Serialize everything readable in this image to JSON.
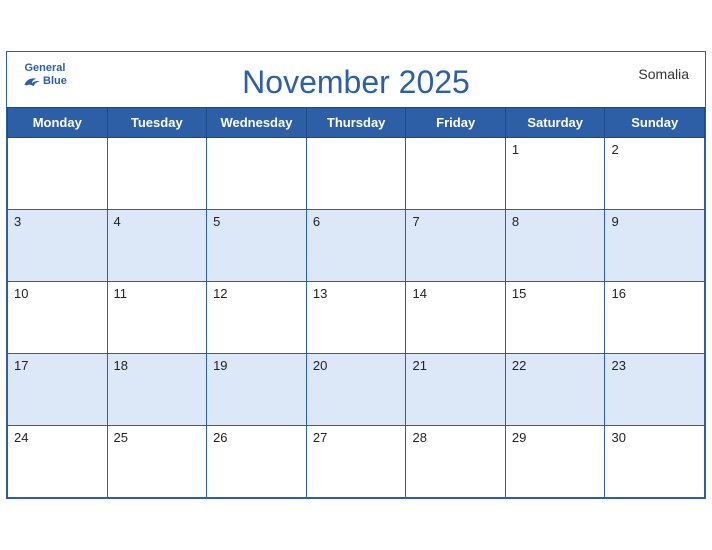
{
  "header": {
    "logo": {
      "general": "General",
      "blue": "Blue"
    },
    "title": "November 2025",
    "country": "Somalia"
  },
  "weekdays": [
    "Monday",
    "Tuesday",
    "Wednesday",
    "Thursday",
    "Friday",
    "Saturday",
    "Sunday"
  ],
  "weeks": [
    [
      null,
      null,
      null,
      null,
      null,
      1,
      2
    ],
    [
      3,
      4,
      5,
      6,
      7,
      8,
      9
    ],
    [
      10,
      11,
      12,
      13,
      14,
      15,
      16
    ],
    [
      17,
      18,
      19,
      20,
      21,
      22,
      23
    ],
    [
      24,
      25,
      26,
      27,
      28,
      29,
      30
    ]
  ],
  "darkRows": [
    1,
    3
  ]
}
